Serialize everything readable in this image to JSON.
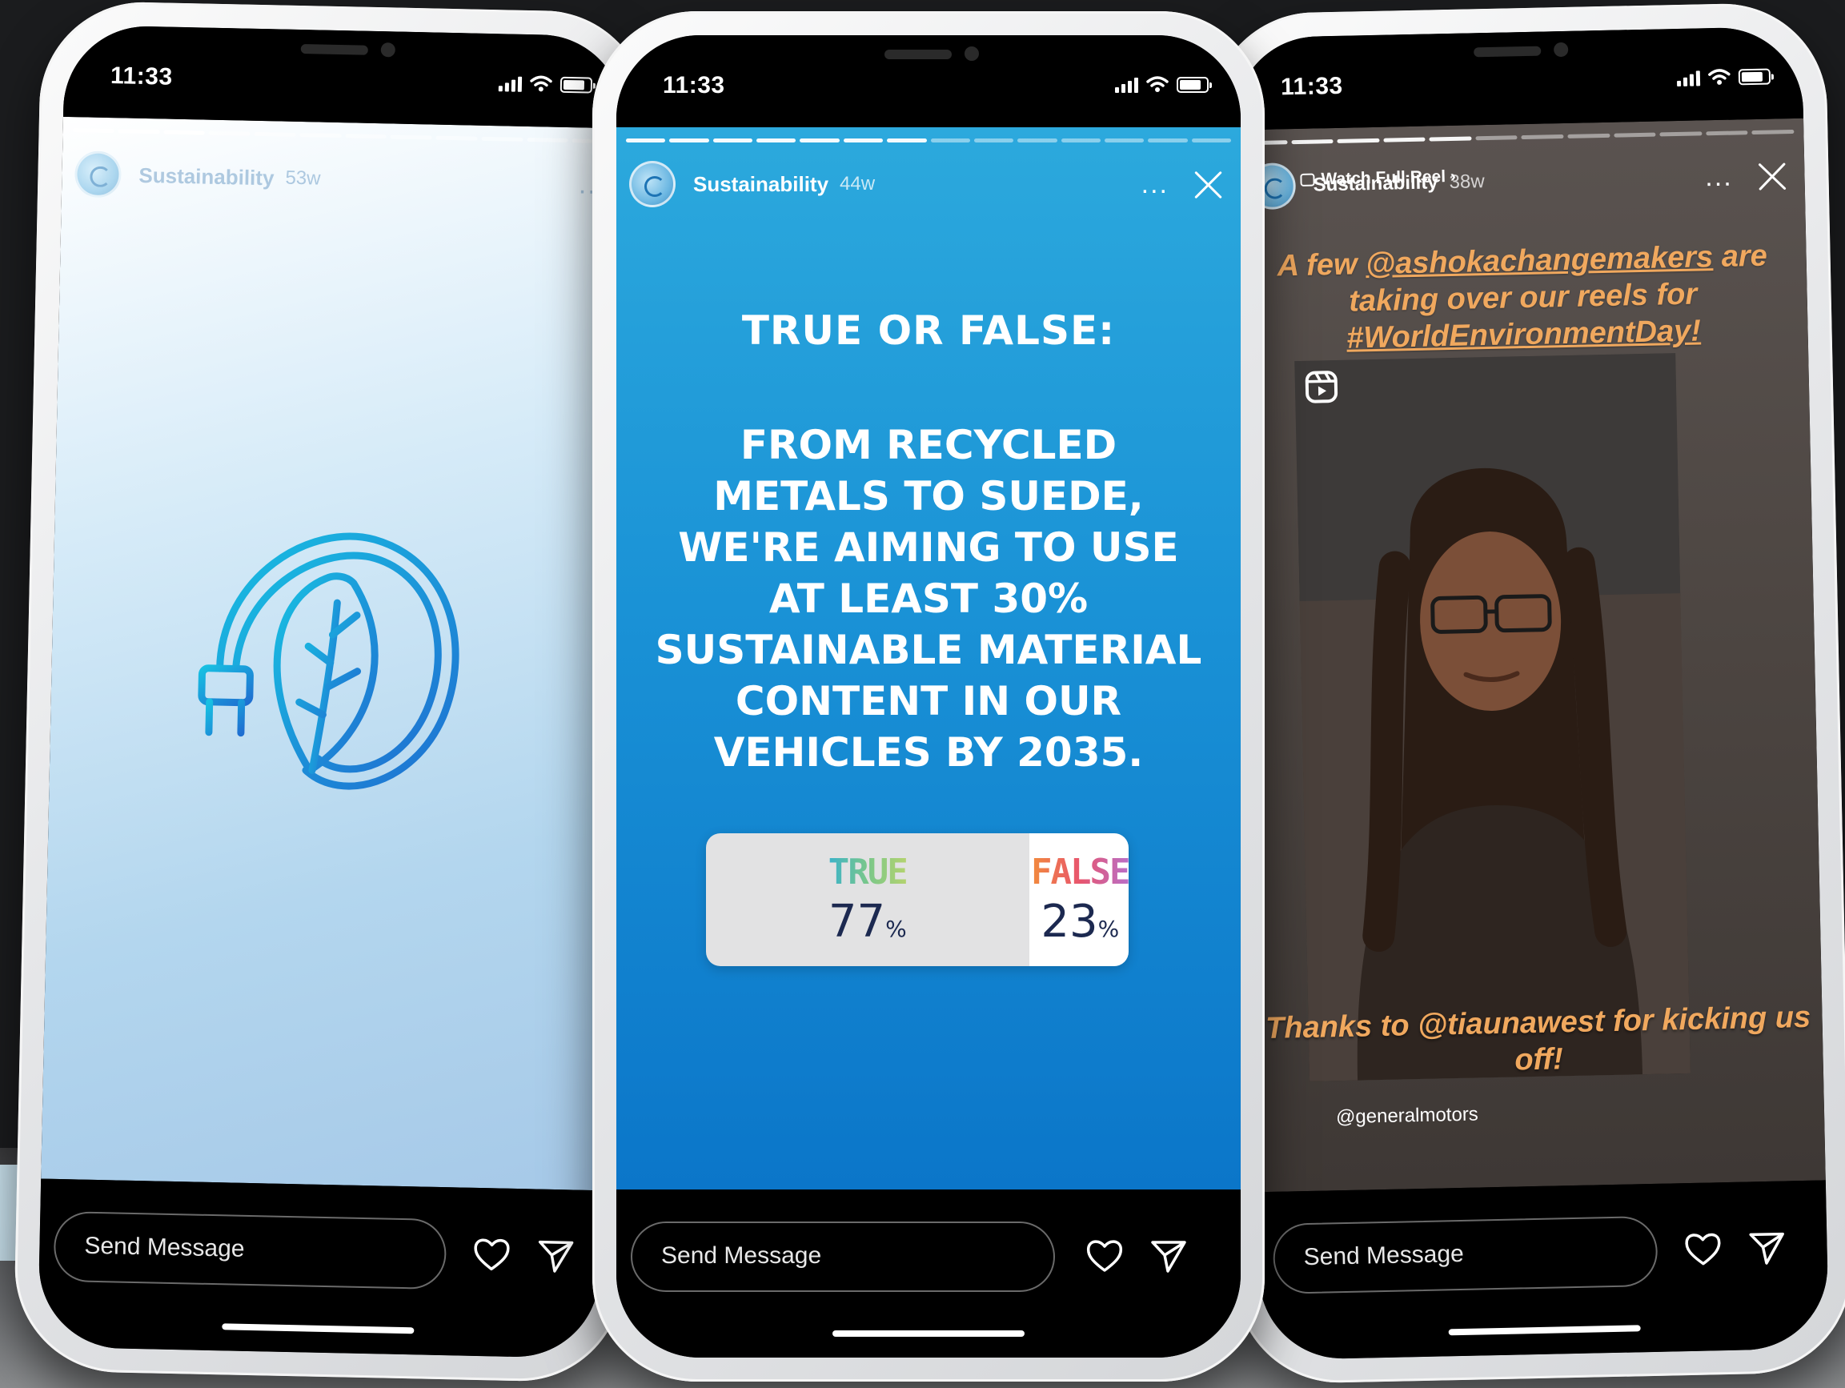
{
  "phones": [
    {
      "time": "11:33",
      "account": "Sustainability",
      "age": "53w",
      "more": "...",
      "send_placeholder": "Send Message",
      "logo_icon": "leaf-plug-icon"
    },
    {
      "time": "11:33",
      "account": "Sustainability",
      "age": "44w",
      "more": "...",
      "send_placeholder": "Send Message",
      "quiz_title": "TRUE OR FALSE:",
      "quiz_body": "FROM RECYCLED METALS TO SUEDE, WE'RE AIMING TO USE AT LEAST 30% SUSTAINABLE MATERIAL CONTENT IN OUR VEHICLES BY 2035.",
      "poll": {
        "true_label": "TRUE",
        "true_value": "77",
        "false_label": "FALSE",
        "false_value": "23",
        "unit": "%"
      }
    },
    {
      "time": "11:33",
      "account": "Sustainability",
      "age": "38w",
      "more": "...",
      "watch_reel": "Watch Full Reel ›",
      "caption_top_pre": "A few ",
      "caption_top_handle": "@ashokachangemakers",
      "caption_top_mid": " are taking over our reels for ",
      "caption_top_tag": "#WorldEnvironmentDay!",
      "caption_bottom": "Thanks to @tiaunawest for kicking us off!",
      "handle": "@generalmotors",
      "send_placeholder": "Send Message"
    }
  ],
  "colors": {
    "phone2_story_top": "#2ca9dd",
    "phone2_story_bottom": "#0b76c9",
    "caption_orange": "#f0a85e",
    "poll_value": "#1c2950"
  }
}
